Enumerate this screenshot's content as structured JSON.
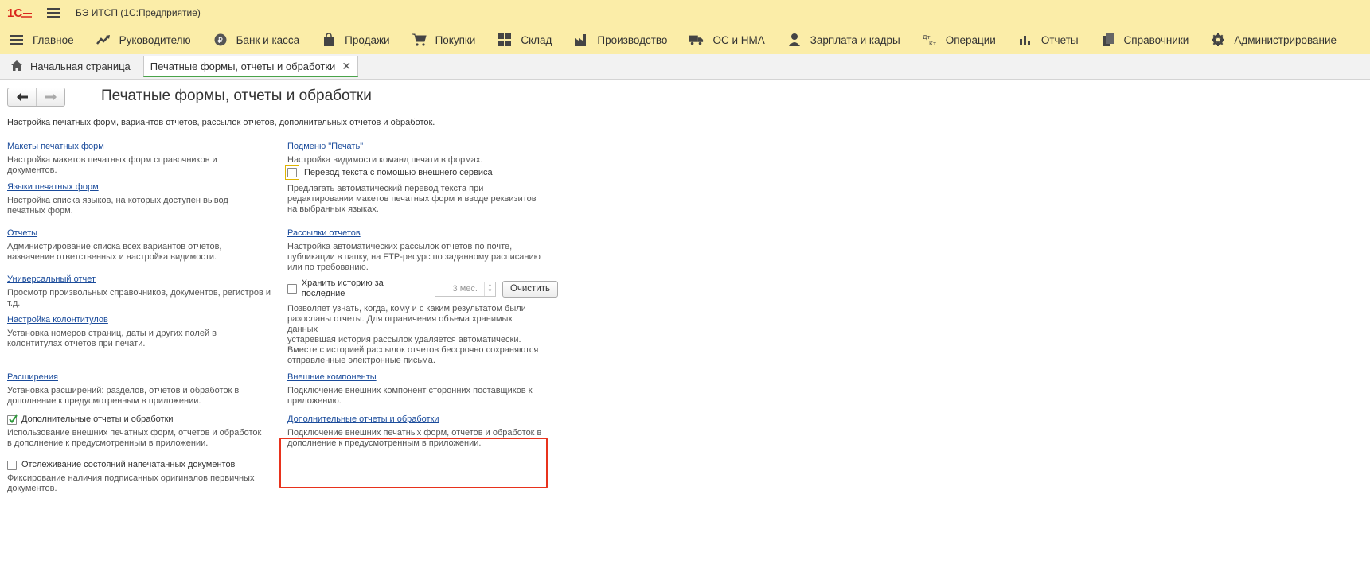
{
  "app": {
    "title": "БЭ ИТСП  (1С:Предприятие)"
  },
  "sections": [
    {
      "label": "Главное",
      "icon": "hamburger-icon"
    },
    {
      "label": "Руководителю",
      "icon": "trend-icon"
    },
    {
      "label": "Банк и касса",
      "icon": "ruble-coin-icon"
    },
    {
      "label": "Продажи",
      "icon": "shopping-bag-icon"
    },
    {
      "label": "Покупки",
      "icon": "cart-icon"
    },
    {
      "label": "Склад",
      "icon": "grid-icon"
    },
    {
      "label": "Производство",
      "icon": "factory-icon"
    },
    {
      "label": "ОС и НМА",
      "icon": "truck-icon"
    },
    {
      "label": "Зарплата и кадры",
      "icon": "person-icon"
    },
    {
      "label": "Операции",
      "icon": "debit-credit-icon"
    },
    {
      "label": "Отчеты",
      "icon": "bar-chart-icon"
    },
    {
      "label": "Справочники",
      "icon": "books-icon"
    },
    {
      "label": "Администрирование",
      "icon": "gear-icon"
    }
  ],
  "tabs": {
    "home": "Начальная страница",
    "active": "Печатные формы, отчеты и обработки"
  },
  "page": {
    "title": "Печатные формы, отчеты и обработки",
    "description": "Настройка печатных форм, вариантов отчетов, рассылок отчетов, дополнительных отчетов и обработок."
  },
  "left": {
    "templates": {
      "link": "Макеты печатных форм",
      "desc1": "Настройка макетов печатных форм справочников и",
      "desc2": "документов."
    },
    "languages": {
      "link": "Языки печатных форм",
      "desc1": "Настройка списка языков, на которых доступен вывод",
      "desc2": "печатных форм."
    },
    "reports": {
      "link": "Отчеты",
      "desc1": "Администрирование списка всех вариантов отчетов,",
      "desc2": "назначение ответственных и настройка видимости."
    },
    "universal": {
      "link": "Универсальный отчет",
      "desc1": "Просмотр произвольных справочников, документов, регистров и",
      "desc2": "т.д."
    },
    "headers": {
      "link": "Настройка колонтитулов",
      "desc1": "Установка номеров страниц, даты и других полей в",
      "desc2": "колонтитулах отчетов при печати."
    },
    "extensions": {
      "link": "Расширения",
      "desc1": "Установка расширений: разделов, отчетов и обработок в",
      "desc2": "дополнение к предусмотренным в приложении."
    },
    "additional": {
      "label": "Дополнительные отчеты и обработки",
      "checked": true,
      "desc1": "Использование внешних печатных форм, отчетов и обработок",
      "desc2": "в дополнение к предусмотренным в приложении."
    },
    "tracking": {
      "label": "Отслеживание состояний напечатанных документов",
      "checked": false,
      "desc1": "Фиксирование наличия подписанных оригиналов первичных",
      "desc2": "документов."
    }
  },
  "right": {
    "print_submenu": {
      "link": "Подменю \"Печать\"",
      "desc1": "Настройка видимости команд печати в формах."
    },
    "translation": {
      "label": "Перевод текста с помощью внешнего сервиса",
      "checked": false,
      "desc1": "Предлагать автоматический перевод текста при",
      "desc2": "редактировании макетов печатных форм и вводе реквизитов",
      "desc3": "на выбранных языках."
    },
    "mailings": {
      "link": "Рассылки отчетов",
      "desc1": "Настройка автоматических рассылок отчетов по почте,",
      "desc2": "публикации в папку, на FTP-ресурс по заданному расписанию",
      "desc3": "или по требованию."
    },
    "history": {
      "label": "Хранить историю за последние",
      "checked": false,
      "value": "3 мес.",
      "clear_button": "Очистить",
      "desc1": "Позволяет узнать, когда, кому и с каким результатом были",
      "desc2": "разосланы отчеты. Для ограничения объема хранимых",
      "desc3": "данных",
      "desc4": "устаревшая история рассылок удаляется автоматически.",
      "desc5": "Вместе с историей рассылок отчетов бессрочно сохраняются",
      "desc6": "отправленные электронные письма."
    },
    "components": {
      "link": "Внешние компоненты",
      "desc1": "Подключение внешних компонент сторонних поставщиков к",
      "desc2": "приложению."
    },
    "ext_reports": {
      "link": "Дополнительные отчеты и обработки",
      "desc1": "Подключение внешних печатных форм, отчетов и обработок в",
      "desc2": "дополнение к предусмотренным в приложении."
    }
  },
  "colors": {
    "link": "#1a4b9b",
    "highlight": "#e8321c",
    "header_bg": "#fbeda8",
    "active_tab_accent": "#4aa34a"
  }
}
